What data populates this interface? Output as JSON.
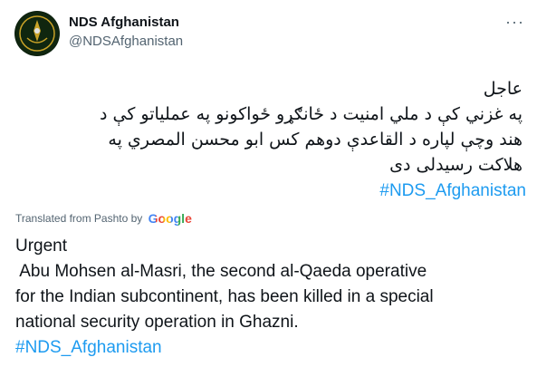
{
  "account": {
    "name": "NDS Afghanistan",
    "handle": "@NDSAfghanistan"
  },
  "more_icon": "more-dots-icon",
  "original": {
    "lines": [
      "عاجل",
      "په غزني کې د ملي امنیت د ځانګړو ځواکونو په عملیاتو کې د",
      "هند وچې لپاره د القاعدې دوهم کس ابو محسن المصري په",
      "هلاکت رسیدلی دی"
    ],
    "hashtag": "#NDS_Afghanistan"
  },
  "translation": {
    "label": "Translated from Pashto by",
    "provider": "Google",
    "lines": [
      "Urgent",
      " Abu Mohsen al-Masri, the second al-Qaeda operative",
      "for the Indian subcontinent, has been killed in a special",
      "national security operation in Ghazni."
    ],
    "hashtag": "#NDS_Afghanistan"
  },
  "colors": {
    "link": "#1d9bf0",
    "text": "#0f1419",
    "secondary": "#536471"
  }
}
